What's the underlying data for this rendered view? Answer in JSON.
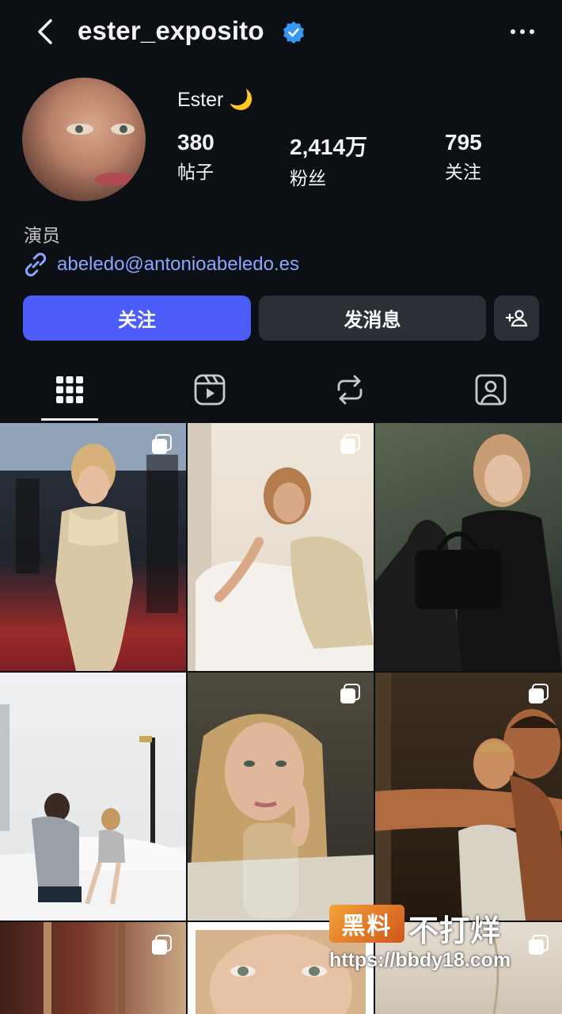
{
  "header": {
    "username": "ester_exposito",
    "verified": true,
    "back_icon": "chevron-left-icon",
    "more_icon": "more-horizontal-icon"
  },
  "profile": {
    "display_name": "Ester 🌙",
    "stats": [
      {
        "value": "380",
        "label": "帖子"
      },
      {
        "value": "2,414万",
        "label": "粉丝"
      },
      {
        "value": "795",
        "label": "关注"
      }
    ],
    "bio": "演员",
    "link": "abeledo@antonioabeledo.es"
  },
  "actions": {
    "follow_label": "关注",
    "message_label": "发消息",
    "add_icon": "person-add-icon"
  },
  "tabs": [
    {
      "icon": "grid-icon",
      "active": true
    },
    {
      "icon": "reels-icon",
      "active": false
    },
    {
      "icon": "repost-icon",
      "active": false
    },
    {
      "icon": "tagged-icon",
      "active": false
    }
  ],
  "watermark": {
    "badge": "黑料",
    "text": "不打烊",
    "url": "https://bbdy18.com"
  },
  "colors": {
    "background": "#0c0f14",
    "accent": "#4b5cf8",
    "link": "#8aa7ff",
    "button_secondary": "#2b2f36",
    "verified": "#3897f0"
  }
}
